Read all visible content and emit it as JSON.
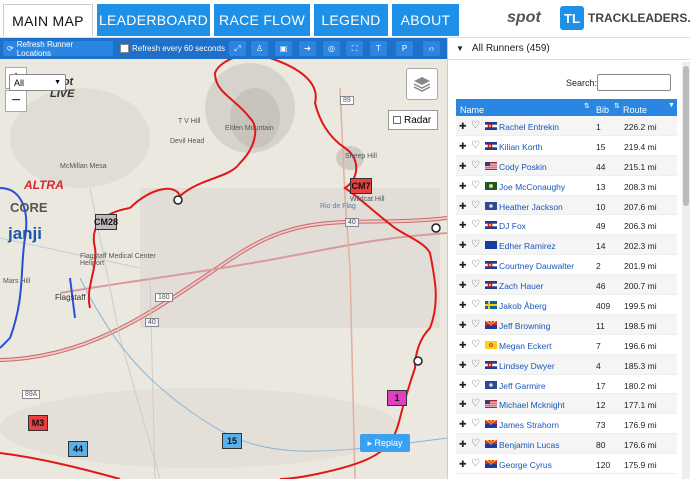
{
  "nav": {
    "tabs": [
      {
        "label": "MAIN MAP",
        "active": true
      },
      {
        "label": "LEADERBOARD",
        "active": false
      },
      {
        "label": "RACE FLOW",
        "active": false
      },
      {
        "label": "LEGEND",
        "active": false
      },
      {
        "label": "ABOUT",
        "active": false
      }
    ],
    "brand_spot": "spot",
    "brand_tl_badge": "TL",
    "brand_tl_text": "TRACKLEADERS.COM"
  },
  "toolbar": {
    "refresh_label": "Refresh Runner Locations",
    "auto_refresh_label": "Refresh every 60 seconds",
    "icon_buttons": [
      "expand-icon",
      "person-icon",
      "image-icon",
      "arrow-right-icon",
      "target-icon",
      "fullscreen-icon",
      "T",
      "P",
      "chevron-icon"
    ]
  },
  "map": {
    "zoom_in": "+",
    "zoom_out": "−",
    "radar_label": "Radar",
    "replay_label": "▸ Replay",
    "spot_live": "spot LIVE",
    "sponsors": [
      "ALTRA",
      "CORE",
      "janji"
    ],
    "labels": [
      "McMillan Mesa",
      "Elden Mountain",
      "T V Hill",
      "Devil Head",
      "Sheep Hill",
      "Wildcat Hill",
      "Flagstaff",
      "Mars Hill",
      "Flagstaff Medical Center Heliport",
      "Rio de Flag"
    ],
    "road_labels": [
      "89",
      "180",
      "40",
      "40",
      "89A"
    ],
    "markers": [
      {
        "label": "CM7",
        "color": "#e84040"
      },
      {
        "label": "CM28",
        "color": "#bbbbbb"
      },
      {
        "label": "M3",
        "color": "#e84040"
      },
      {
        "label": "44",
        "color": "#5ab0e8"
      },
      {
        "label": "15",
        "color": "#5ab0e8"
      },
      {
        "label": "1",
        "color": "#e040c0"
      }
    ]
  },
  "panel": {
    "header": "All Runners (459)",
    "show_select": "All",
    "search_label": "Search:",
    "search_value": "",
    "columns": [
      "Name",
      "Bib",
      "Route Mile"
    ],
    "runners": [
      {
        "name": "Rachel Entrekin",
        "bib": "1",
        "mile": "226.2 mi",
        "flag": "colorado"
      },
      {
        "name": "Kilian Korth",
        "bib": "15",
        "mile": "219.4 mi",
        "flag": "colorado"
      },
      {
        "name": "Cody Poskin",
        "bib": "44",
        "mile": "215.1 mi",
        "flag": "usa"
      },
      {
        "name": "Joe McConaughy",
        "bib": "13",
        "mile": "208.3 mi",
        "flag": "massachusetts"
      },
      {
        "name": "Heather Jackson",
        "bib": "10",
        "mile": "207.6 mi",
        "flag": "blue-state"
      },
      {
        "name": "DJ Fox",
        "bib": "49",
        "mile": "206.3 mi",
        "flag": "colorado"
      },
      {
        "name": "Edher Ramirez",
        "bib": "14",
        "mile": "202.3 mi",
        "flag": "eu"
      },
      {
        "name": "Courtney Dauwalter",
        "bib": "2",
        "mile": "201.9 mi",
        "flag": "colorado"
      },
      {
        "name": "Zach Hauer",
        "bib": "46",
        "mile": "200.7 mi",
        "flag": "colorado"
      },
      {
        "name": "Jakob Åberg",
        "bib": "409",
        "mile": "199.5 mi",
        "flag": "sweden"
      },
      {
        "name": "Jeff Browning",
        "bib": "11",
        "mile": "198.5 mi",
        "flag": "arizona"
      },
      {
        "name": "Megan Eckert",
        "bib": "7",
        "mile": "196.6 mi",
        "flag": "new-mexico"
      },
      {
        "name": "Lindsey Dwyer",
        "bib": "4",
        "mile": "185.3 mi",
        "flag": "colorado"
      },
      {
        "name": "Jeff Garmire",
        "bib": "17",
        "mile": "180.2 mi",
        "flag": "blue-state"
      },
      {
        "name": "Michael Mcknight",
        "bib": "12",
        "mile": "177.1 mi",
        "flag": "usa"
      },
      {
        "name": "James Strahorn",
        "bib": "73",
        "mile": "176.9 mi",
        "flag": "arizona"
      },
      {
        "name": "Benjamin Lucas",
        "bib": "80",
        "mile": "176.6 mi",
        "flag": "arizona"
      },
      {
        "name": "George Cyrus",
        "bib": "120",
        "mile": "175.9 mi",
        "flag": "arizona"
      }
    ]
  }
}
